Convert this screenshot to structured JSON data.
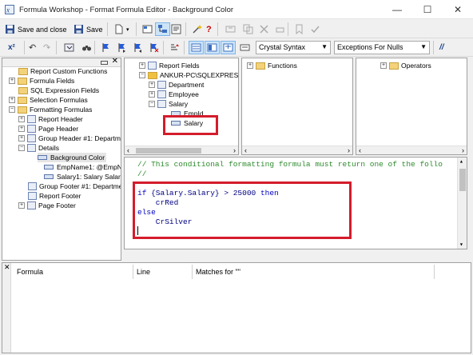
{
  "window": {
    "title": "Formula Workshop - Format Formula Editor - Background Color",
    "minimize": "—",
    "maximize": "☐",
    "close": "✕"
  },
  "toolbar1": {
    "save_close_label": "Save and close",
    "save_label": "Save"
  },
  "toolbar2": {
    "syntax_value": "Crystal Syntax",
    "exceptions_value": "Exceptions For Nulls"
  },
  "left_tree": {
    "items": [
      {
        "label": "Report Custom Functions"
      },
      {
        "label": "Formula Fields"
      },
      {
        "label": "SQL Expression Fields"
      },
      {
        "label": "Selection Formulas"
      },
      {
        "label": "Formatting Formulas"
      },
      {
        "label": "Report Header"
      },
      {
        "label": "Page Header"
      },
      {
        "label": "Group Header #1: Departme"
      },
      {
        "label": "Details"
      },
      {
        "label": "Background Color"
      },
      {
        "label": "EmpName1: @EmpNa"
      },
      {
        "label": "Salary1: Salary Salary"
      },
      {
        "label": "Group Footer #1: Departmen"
      },
      {
        "label": "Report Footer"
      },
      {
        "label": "Page Footer"
      }
    ]
  },
  "fields_tree": {
    "items": [
      {
        "label": "Report Fields"
      },
      {
        "label": "ANKUR-PC\\SQLEXPRES"
      },
      {
        "label": "Department"
      },
      {
        "label": "Employee"
      },
      {
        "label": "Salary"
      },
      {
        "label": "EmpId"
      },
      {
        "label": "Salary"
      }
    ]
  },
  "functions_tree": {
    "label": "Functions"
  },
  "operators_tree": {
    "label": "Operators"
  },
  "editor": {
    "line1": "// This conditional formatting formula must return one of the follo",
    "line2": "//",
    "line3_if": "if",
    "line3_field": " {Salary.Salary} > 25000 ",
    "line3_then": "then",
    "line4": "    crRed",
    "line5": "else",
    "line6": "    CrSilver"
  },
  "results": {
    "col_formula": "Formula",
    "col_line": "Line",
    "col_matches": "Matches for \"\""
  },
  "colors": {
    "highlight": "#d41c2c",
    "keyword": "#0000c0",
    "comment": "#2e8b2e"
  }
}
